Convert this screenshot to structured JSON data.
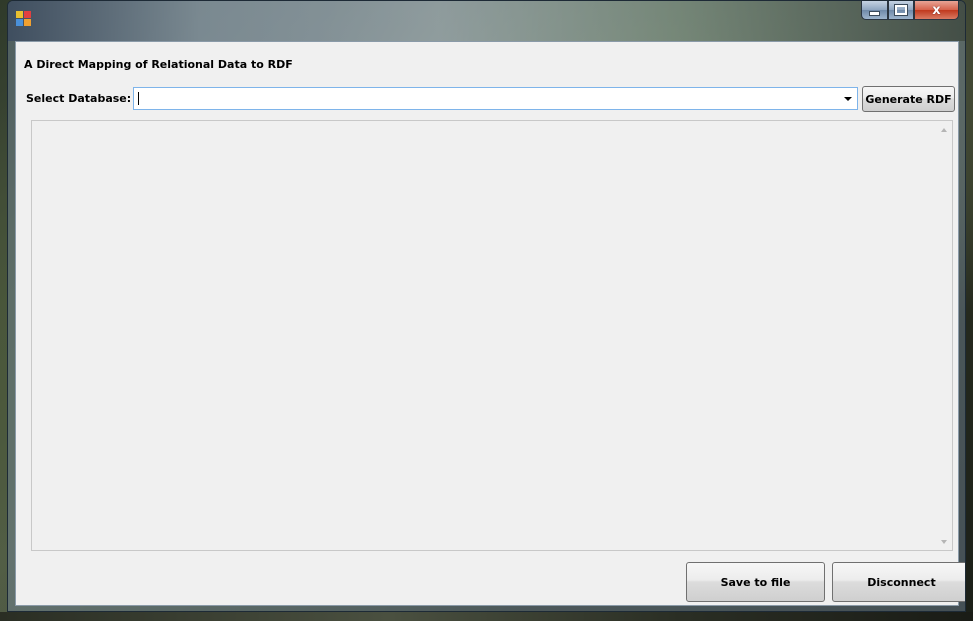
{
  "window": {
    "icon": "app-icon",
    "title": "",
    "controls": {
      "minimize_icon": "minimize-icon",
      "maximize_icon": "maximize-icon",
      "close_icon": "close-icon",
      "close_glyph": "x"
    }
  },
  "form": {
    "heading": "A Direct Mapping of Relational Data to RDF",
    "database_label": "Select Database:",
    "database_value": "",
    "database_placeholder": "",
    "generate_button": "Generate RDF",
    "output_text": "",
    "save_button": "Save to file",
    "disconnect_button": "Disconnect"
  },
  "colors": {
    "client_background": "#f0f0f0",
    "combo_border_focus": "#7eb4ea",
    "close_button": "#c0391e"
  }
}
